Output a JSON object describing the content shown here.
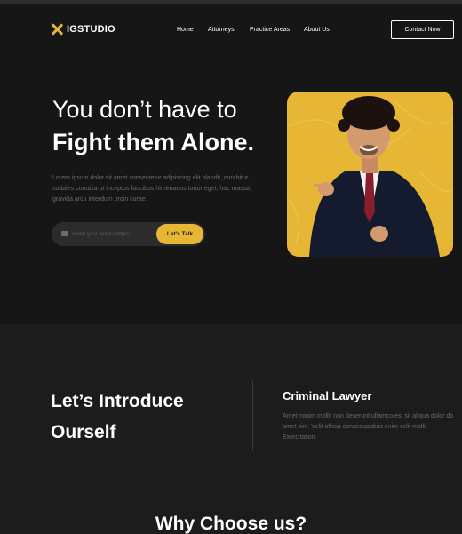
{
  "brand": {
    "name": "IGSTUDIO",
    "accent": "#e8b635"
  },
  "nav": {
    "items": [
      "Home",
      "Attorneys",
      "Practice Areas",
      "About Us"
    ],
    "cta": "Contact Now"
  },
  "hero": {
    "headline_line1": "You don’t have to",
    "headline_line2": "Fight them Alone.",
    "body": "Lorem ipsum dolor sit amet consectetur adipiscing elit blandit, curabitur sodales conubia ut inceptos faucibus himenaeos tortor eget, hac massa gravida arcu interdum proin curae.",
    "email_placeholder": "Enter your semil address",
    "cta": "Let's Talk"
  },
  "intro": {
    "heading": "Let’s Introduce Ourself",
    "role_title": "Criminal Lawyer",
    "role_desc": "Amet minim mollit non deserunt ullamco est sit aliqua dolor do amet sint. Velit officia consequatduis enim velit mollit Exercitation."
  },
  "why": {
    "heading": "Why Choose us?"
  }
}
